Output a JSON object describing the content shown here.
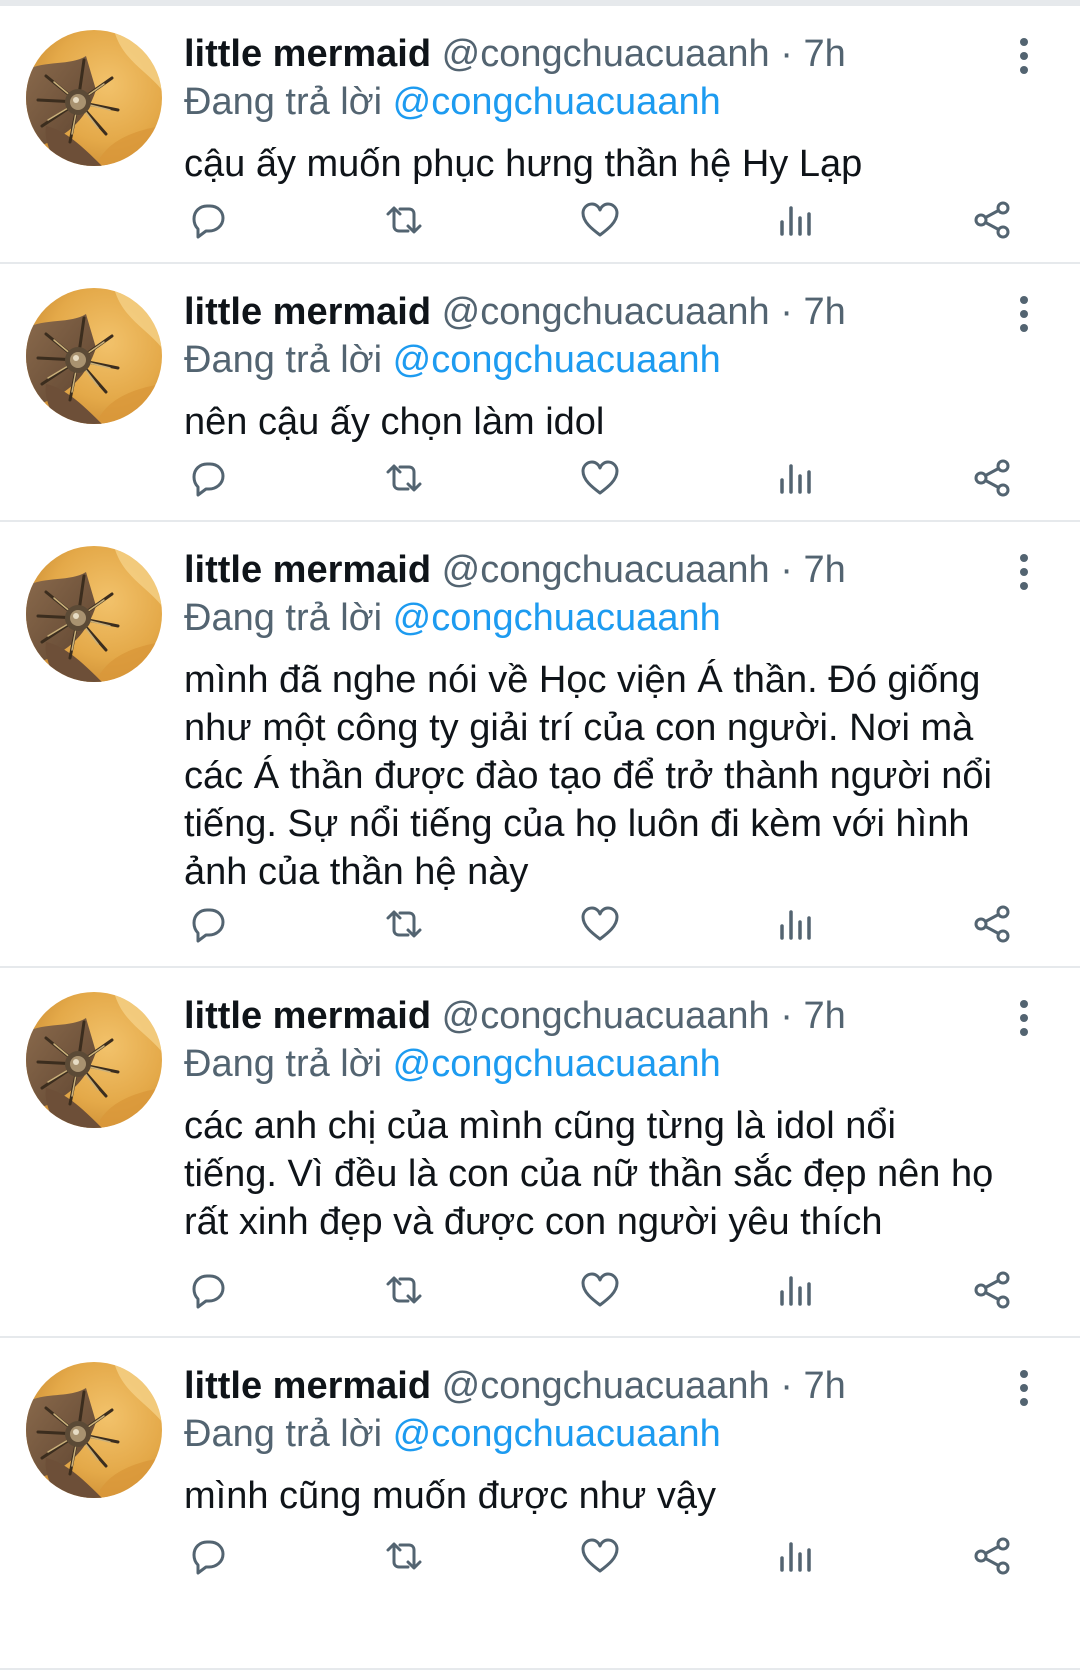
{
  "tweets": [
    {
      "name": "little mermaid",
      "handle": "@congchuacuaanh",
      "dot": "·",
      "time": "7h",
      "reply_prefix": "Đang trả lời",
      "reply_to": "@congchuacuaanh",
      "text": "cậu ấy muốn phục hưng thần hệ Hy Lạp"
    },
    {
      "name": "little mermaid",
      "handle": "@congchuacuaanh",
      "dot": "·",
      "time": "7h",
      "reply_prefix": "Đang trả lời",
      "reply_to": "@congchuacuaanh",
      "text": "nên cậu ấy chọn làm idol"
    },
    {
      "name": "little mermaid",
      "handle": "@congchuacuaanh",
      "dot": "·",
      "time": "7h",
      "reply_prefix": "Đang trả lời",
      "reply_to": "@congchuacuaanh",
      "text": "mình đã nghe nói về Học viện Á thần. Đó giống\nnhư một công ty giải trí của con người. Nơi mà\ncác Á thần được đào tạo để trở thành người nổi\ntiếng. Sự nổi tiếng của họ luôn đi kèm với hình\nảnh của thần hệ này"
    },
    {
      "name": "little mermaid",
      "handle": "@congchuacuaanh",
      "dot": "·",
      "time": "7h",
      "reply_prefix": "Đang trả lời",
      "reply_to": "@congchuacuaanh",
      "text": "các anh chị của mình cũng từng là idol nổi\ntiếng. Vì đều là con của nữ thần sắc đẹp nên họ\nrất xinh đẹp và được con người yêu thích"
    },
    {
      "name": "little mermaid",
      "handle": "@congchuacuaanh",
      "dot": "·",
      "time": "7h",
      "reply_prefix": "Đang trả lời",
      "reply_to": "@congchuacuaanh",
      "text": "mình cũng muốn được như vậy"
    }
  ],
  "icons": {
    "reply": "reply-icon",
    "retweet": "retweet-icon",
    "like": "heart-icon",
    "views": "analytics-icon",
    "share": "share-icon",
    "more": "more-vertical-icon"
  },
  "colors": {
    "text": "#0f1419",
    "secondary": "#536471",
    "mention": "#1d9bf0",
    "divider": "#e6e9ec"
  }
}
